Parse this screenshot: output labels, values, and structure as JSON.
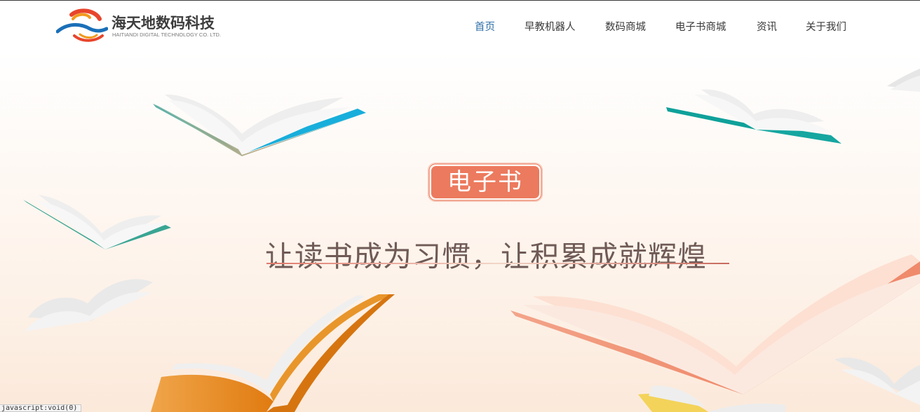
{
  "brand": {
    "name": "海天地数码科技",
    "subtitle": "HAITIANDI DIGITAL TECHNOLOGY CO. LTD.",
    "logo_icon": "wave-swirl-logo",
    "colors": {
      "red": "#e8452c",
      "orange": "#f19a1f",
      "blue": "#1a6fb8"
    }
  },
  "nav": {
    "items": [
      {
        "label": "首页",
        "active": true
      },
      {
        "label": "早教机器人",
        "active": false
      },
      {
        "label": "数码商城",
        "active": false
      },
      {
        "label": "电子书商城",
        "active": false
      },
      {
        "label": "资讯",
        "active": false
      },
      {
        "label": "关于我们",
        "active": false
      }
    ],
    "active_color": "#2c6ea6",
    "color": "#3a3a3a"
  },
  "hero": {
    "badge": "电子书",
    "slogan": "让读书成为习惯，让积累成就辉煌",
    "badge_color": "#ec7a5e",
    "slogan_color": "#6f5a56",
    "book_colors": [
      "#2db3dc",
      "#1aa39a",
      "#3aa593",
      "#e8962b",
      "#f08a6e",
      "#f3d35a"
    ]
  },
  "status": {
    "text": "javascript:void(0)"
  }
}
